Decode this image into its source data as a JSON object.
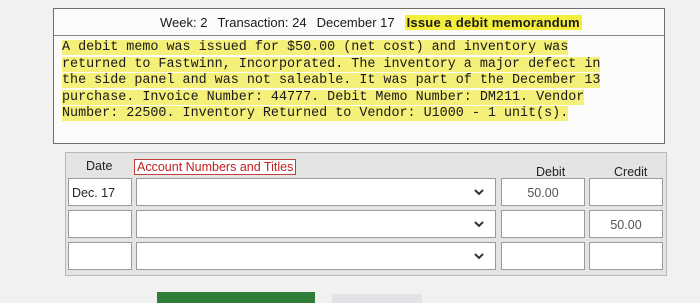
{
  "task": {
    "week": "Week: 2",
    "transaction": "Transaction: 24",
    "date": "December 17",
    "title": "Issue a debit memorandum",
    "description_lines": [
      "A debit memo was issued for $50.00 (net cost) and inventory was",
      "returned to Fastwinn, Incorporated. The inventory a major defect in",
      "the side panel and was not saleable. It was part of the December 13",
      "purchase. Invoice Number: 44777. Debit Memo Number: DM211. Vendor",
      "Number: 22500. Inventory Returned to Vendor: U1000 - 1 unit(s)."
    ]
  },
  "journal": {
    "headers": {
      "date": "Date",
      "account": "Account Numbers and Titles",
      "debit": "Debit",
      "credit": "Credit"
    },
    "rows": [
      {
        "date": "Dec. 17",
        "account": "",
        "debit": "50.00",
        "credit": ""
      },
      {
        "date": "",
        "account": "",
        "debit": "",
        "credit": "50.00"
      },
      {
        "date": "",
        "account": "",
        "debit": "",
        "credit": ""
      }
    ]
  },
  "icons": {
    "dropdown": "chevron-down-icon"
  },
  "colors": {
    "highlight": "#f3ef3a",
    "button": "#2f7d36"
  }
}
